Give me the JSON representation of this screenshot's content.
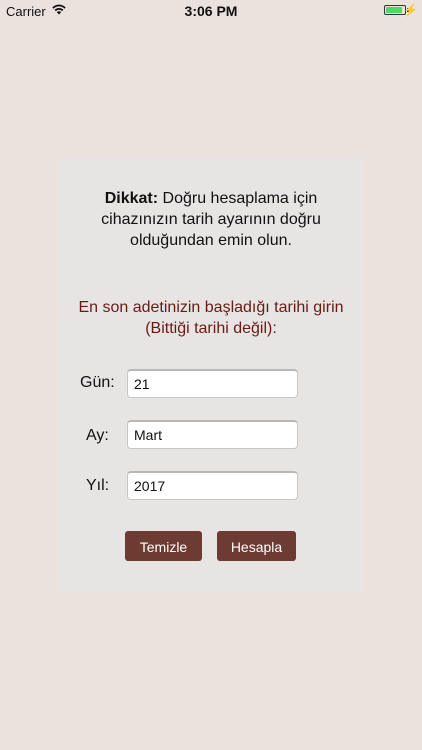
{
  "status_bar": {
    "carrier": "Carrier",
    "time": "3:06 PM",
    "battery_level_percent": 90,
    "icons": [
      "wifi-icon",
      "battery-icon",
      "charging-bolt-icon"
    ]
  },
  "warning": {
    "bold_prefix": "Dikkat:",
    "text": " Doğru hesaplama için cihazınızın tarih ayarının doğru olduğundan emin olun."
  },
  "prompt": "En son adetinizin başladığı tarihi girin (Bittiği tarihi değil):",
  "form": {
    "day_label": "Gün:",
    "day_value": "21",
    "month_label": "Ay:",
    "month_value": "Mart",
    "year_label": "Yıl:",
    "year_value": "2017"
  },
  "buttons": {
    "clear": "Temizle",
    "calculate": "Hesapla"
  },
  "colors": {
    "background": "#ebe1dd",
    "card": "#e7e4e4",
    "accent_text": "#6b1a12",
    "button": "#6e3b33"
  }
}
